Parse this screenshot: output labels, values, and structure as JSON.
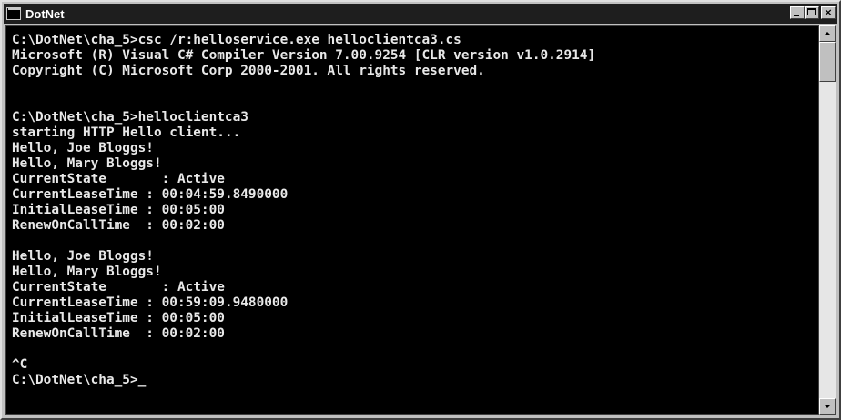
{
  "window": {
    "title": "DotNet",
    "buttons": {
      "minimize": "minimize",
      "maximize": "maximize",
      "close": "×"
    }
  },
  "console": {
    "lines": [
      "",
      "C:\\DotNet\\cha_5>csc /r:helloservice.exe helloclientca3.cs",
      "Microsoft (R) Visual C# Compiler Version 7.00.9254 [CLR version v1.0.2914]",
      "Copyright (C) Microsoft Corp 2000-2001. All rights reserved.",
      "",
      "",
      "C:\\DotNet\\cha_5>helloclientca3",
      "starting HTTP Hello client...",
      "Hello, Joe Bloggs!",
      "Hello, Mary Bloggs!",
      "CurrentState       : Active",
      "CurrentLeaseTime : 00:04:59.8490000",
      "InitialLeaseTime : 00:05:00",
      "RenewOnCallTime  : 00:02:00",
      "",
      "Hello, Joe Bloggs!",
      "Hello, Mary Bloggs!",
      "CurrentState       : Active",
      "CurrentLeaseTime : 00:59:09.9480000",
      "InitialLeaseTime : 00:05:00",
      "RenewOnCallTime  : 00:02:00",
      "",
      "^C",
      "C:\\DotNet\\cha_5>"
    ],
    "cursor": "_"
  }
}
